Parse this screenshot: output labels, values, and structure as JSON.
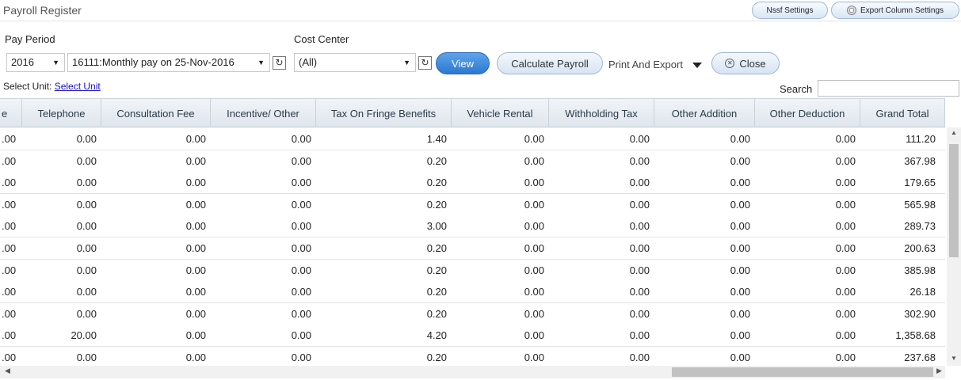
{
  "app": {
    "title": "Payroll Register",
    "nssf_button": "Nssf Settings",
    "export_settings_button": "Export Column Settings"
  },
  "filters": {
    "pay_period_label": "Pay Period",
    "year_value": "2016",
    "period_value": "16111:Monthly pay on 25-Nov-2016",
    "cost_center_label": "Cost Center",
    "cost_center_value": "(All)",
    "view_button": "View",
    "calculate_button": "Calculate Payroll",
    "print_export": "Print And Export",
    "close_button": "Close",
    "select_unit_label": "Select Unit:",
    "select_unit_link": "Select Unit",
    "search_label": "Search",
    "search_value": ""
  },
  "table": {
    "columns": [
      "e",
      "Telephone",
      "Consultation Fee",
      "Incentive/ Other",
      "Tax On Fringe Benefits",
      "Vehicle Rental",
      "Withholding Tax",
      "Other Addition",
      "Other Deduction",
      "Grand Total"
    ],
    "rows": [
      [
        ".00",
        "0.00",
        "0.00",
        "0.00",
        "1.40",
        "0.00",
        "0.00",
        "0.00",
        "0.00",
        "111.20"
      ],
      [
        ".00",
        "0.00",
        "0.00",
        "0.00",
        "0.20",
        "0.00",
        "0.00",
        "0.00",
        "0.00",
        "367.98"
      ],
      [
        ".00",
        "0.00",
        "0.00",
        "0.00",
        "0.20",
        "0.00",
        "0.00",
        "0.00",
        "0.00",
        "179.65"
      ],
      [
        ".00",
        "0.00",
        "0.00",
        "0.00",
        "0.20",
        "0.00",
        "0.00",
        "0.00",
        "0.00",
        "565.98"
      ],
      [
        ".00",
        "0.00",
        "0.00",
        "0.00",
        "3.00",
        "0.00",
        "0.00",
        "0.00",
        "0.00",
        "289.73"
      ],
      [
        ".00",
        "0.00",
        "0.00",
        "0.00",
        "0.20",
        "0.00",
        "0.00",
        "0.00",
        "0.00",
        "200.63"
      ],
      [
        ".00",
        "0.00",
        "0.00",
        "0.00",
        "0.20",
        "0.00",
        "0.00",
        "0.00",
        "0.00",
        "385.98"
      ],
      [
        ".00",
        "0.00",
        "0.00",
        "0.00",
        "0.20",
        "0.00",
        "0.00",
        "0.00",
        "0.00",
        "26.18"
      ],
      [
        ".00",
        "0.00",
        "0.00",
        "0.00",
        "0.20",
        "0.00",
        "0.00",
        "0.00",
        "0.00",
        "302.90"
      ],
      [
        ".00",
        "20.00",
        "0.00",
        "0.00",
        "4.20",
        "0.00",
        "0.00",
        "0.00",
        "0.00",
        "1,358.68"
      ],
      [
        ".00",
        "0.00",
        "0.00",
        "0.00",
        "0.20",
        "0.00",
        "0.00",
        "0.00",
        "0.00",
        "237.68"
      ]
    ]
  },
  "icons": {
    "refresh": "refresh-icon",
    "caret": "chevron-down-icon",
    "close": "close-icon",
    "gear": "gear-icon"
  }
}
